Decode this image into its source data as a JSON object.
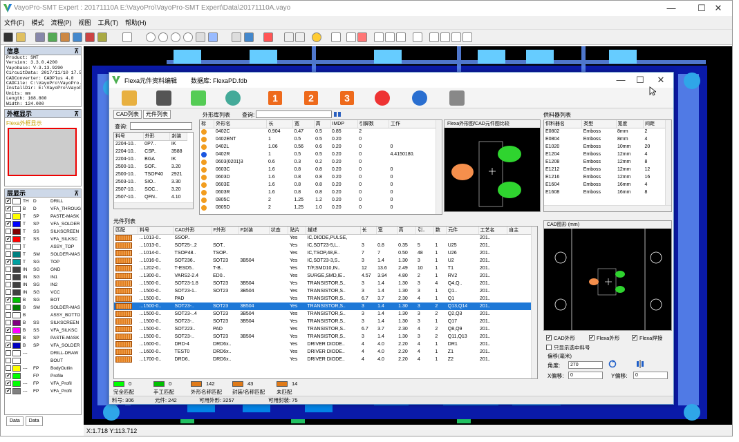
{
  "window": {
    "title": "VayoPro-SMT Expert : 20171110A    E:\\VayoPro\\VayoPro-SMT Expert\\Data\\20171110A.vayo",
    "minimize": "—",
    "maximize": "☐",
    "close": "✕"
  },
  "menu": [
    "文件(F)",
    "模式",
    "流程(P)",
    "视图",
    "工具(T)",
    "帮助(H)"
  ],
  "info_panel": {
    "title": "信息",
    "pin": "⊼",
    "lines": [
      "Product: SMT",
      "Version: 3.3.0.4200",
      "Vayobase: V-3.13.9290",
      "CircuitData: 2017/11/10 17.5",
      "CADConverter: CADPlus 4.0",
      "CADFile: C:\\VayoPro\\VayoPro..",
      "InstallDir: E:\\VayoPro\\VayoPro",
      "Units: mm",
      "Length: 168.800",
      "Width: 124.000",
      "Thickness: 0.000"
    ]
  },
  "ext_panel": {
    "title": "外框显示",
    "pin": "⊼",
    "label": "Flexa外框显示"
  },
  "layers_panel": {
    "title": "层显示",
    "pin": "⊼",
    "rows": [
      {
        "checked": "✔",
        "color": "#ffffff",
        "ab": "TH",
        "nm": "D",
        "label": "DRILL"
      },
      {
        "checked": "✔",
        "color": "#ffffff",
        "ab": "B",
        "nm": "D",
        "label": "VFA_THROUGH"
      },
      {
        "checked": "",
        "color": "#ffff00",
        "ab": "T",
        "nm": "SP",
        "label": "PASTE-MASK"
      },
      {
        "checked": "✔",
        "color": "#0000ff",
        "ab": "T",
        "nm": "SP",
        "label": "VFA_SOLDER"
      },
      {
        "checked": "",
        "color": "#800000",
        "ab": "T",
        "nm": "SS",
        "label": "SILKSCREEN"
      },
      {
        "checked": "✔",
        "color": "#ff0000",
        "ab": "T",
        "nm": "SS",
        "label": "VFA_SILKSC"
      },
      {
        "checked": "",
        "color": "#ffffff",
        "ab": "T",
        "nm": "",
        "label": "ASSY_TOP"
      },
      {
        "checked": "",
        "color": "#008080",
        "ab": "T",
        "nm": "SM",
        "label": "SOLDER-MAS"
      },
      {
        "checked": "✔",
        "color": "#00a0a0",
        "ab": "T",
        "nm": "SG",
        "label": "TOP"
      },
      {
        "checked": "",
        "color": "#404040",
        "ab": "IN",
        "nm": "SG",
        "label": "GND"
      },
      {
        "checked": "",
        "color": "#404040",
        "ab": "IN",
        "nm": "SG",
        "label": "IN1"
      },
      {
        "checked": "",
        "color": "#404040",
        "ab": "IN",
        "nm": "SG",
        "label": "IN2"
      },
      {
        "checked": "",
        "color": "#404040",
        "ab": "IN",
        "nm": "SG",
        "label": "VCC"
      },
      {
        "checked": "✔",
        "color": "#00c000",
        "ab": "B",
        "nm": "SG",
        "label": "BOT"
      },
      {
        "checked": "",
        "color": "#008000",
        "ab": "B",
        "nm": "SM",
        "label": "SOLDER-MAS"
      },
      {
        "checked": "",
        "color": "#ffffff",
        "ab": "B",
        "nm": "",
        "label": "ASSY_BOTTO"
      },
      {
        "checked": "",
        "color": "#800080",
        "ab": "B",
        "nm": "SS",
        "label": "SILKSCREEN"
      },
      {
        "checked": "✔",
        "color": "#ff00ff",
        "ab": "B",
        "nm": "SS",
        "label": "VFA_SILKSC"
      },
      {
        "checked": "",
        "color": "#808000",
        "ab": "B",
        "nm": "SP",
        "label": "PASTE-MASK"
      },
      {
        "checked": "✔",
        "color": "#0000c0",
        "ab": "B",
        "nm": "SP",
        "label": "VFA_SOLDER"
      },
      {
        "checked": "",
        "color": "#ffffff",
        "ab": "---",
        "nm": "",
        "label": "DRILL-DRAW"
      },
      {
        "checked": "",
        "color": "#ffffff",
        "ab": "",
        "nm": "",
        "label": "BOUT"
      },
      {
        "checked": "",
        "color": "#ffff00",
        "ab": "---",
        "nm": "FP",
        "label": "BodyOutlin"
      },
      {
        "checked": "✔",
        "color": "#00ff00",
        "ab": "",
        "nm": "FP",
        "label": "Profile"
      },
      {
        "checked": "✔",
        "color": "#00ff00",
        "ab": "---",
        "nm": "FP",
        "label": "VFA_Profil"
      },
      {
        "checked": "✔",
        "color": "#808080",
        "ab": "---",
        "nm": "FP",
        "label": "VFA_Profil"
      }
    ]
  },
  "bottom_tabs": [
    "Data",
    "Data"
  ],
  "statusbar": {
    "coords": "X:1.718 Y:113.712"
  },
  "dialog": {
    "title": "Flexa元件资料编辑",
    "subtitle": "数据库: FlexaPD.fdb",
    "close": "✕",
    "maximize": "☐",
    "minimize": "—",
    "numbers": [
      "1",
      "2",
      "3"
    ],
    "tabs": [
      "CAD列表",
      "元件列表"
    ],
    "search_label": "查询:",
    "cad_header": [
      "料号",
      "外形",
      "封装"
    ],
    "cad_rows": [
      [
        "2204-10..",
        "0P7..",
        "IK"
      ],
      [
        "2204-10..",
        "CSP..",
        "3588"
      ],
      [
        "2204-10..",
        "BGA",
        "IK"
      ],
      [
        "2500-10..",
        "SOF..",
        "3.20"
      ],
      [
        "2500-10..",
        "TSOP40",
        "2921"
      ],
      [
        "2503-10..",
        "SIO..",
        "3.30"
      ],
      [
        "2507-10..",
        "SOC..",
        "3.20"
      ],
      [
        "2507-10..",
        "QFN..",
        "4.10"
      ]
    ],
    "shape_list_title": "外形库列表",
    "shape_search_label": "查询:",
    "shape_header": [
      "标",
      "外形名",
      "长",
      "宽",
      "高",
      "IMDP",
      "引脚数",
      "工作"
    ],
    "shape_rows": [
      {
        "color": "#f29d1f",
        "name": "0402C",
        "l": "0.904",
        "w": "0.47",
        "h": "0.5",
        "imdp": "0.85",
        "p": "2",
        "t": ""
      },
      {
        "color": "#f29d1f",
        "name": "0402ENT",
        "l": "1",
        "w": "0.5",
        "h": "0.5",
        "imdp": "0.20",
        "p": "0",
        "t": ""
      },
      {
        "color": "#f29d1f",
        "name": "0402L",
        "l": "1.06",
        "w": "0.56",
        "h": "0.6",
        "imdp": "0.20",
        "p": "0",
        "t": "0"
      },
      {
        "color": "#1b56e0",
        "name": "0402R",
        "l": "1",
        "w": "0.5",
        "h": "0.5",
        "imdp": "0.20",
        "p": "0",
        "t": "4.4150180."
      },
      {
        "color": "#f29d1f",
        "name": "0603(0201)3",
        "l": "0.6",
        "w": "0.3",
        "h": "0.2",
        "imdp": "0.20",
        "p": "0",
        "t": ""
      },
      {
        "color": "#f29d1f",
        "name": "0603C",
        "l": "1.6",
        "w": "0.8",
        "h": "0.8",
        "imdp": "0.20",
        "p": "0",
        "t": "0"
      },
      {
        "color": "#f29d1f",
        "name": "0603D",
        "l": "1.6",
        "w": "0.8",
        "h": "0.8",
        "imdp": "0.20",
        "p": "0",
        "t": "0"
      },
      {
        "color": "#f29d1f",
        "name": "0603E",
        "l": "1.6",
        "w": "0.8",
        "h": "0.8",
        "imdp": "0.20",
        "p": "0",
        "t": "0"
      },
      {
        "color": "#f29d1f",
        "name": "0603R",
        "l": "1.6",
        "w": "0.8",
        "h": "0.8",
        "imdp": "0.20",
        "p": "0",
        "t": "0"
      },
      {
        "color": "#f29d1f",
        "name": "0805C",
        "l": "2",
        "w": "1.25",
        "h": "1.2",
        "imdp": "0.20",
        "p": "0",
        "t": "0"
      },
      {
        "color": "#f29d1f",
        "name": "0805D",
        "l": "2",
        "w": "1.25",
        "h": "1.0",
        "imdp": "0.20",
        "p": "0",
        "t": "0"
      }
    ],
    "preview_title": "Flexa外形图/CAD元件图比较",
    "feeder_title": "供料器列表",
    "feeder_header": [
      "供料器名",
      "类型",
      "宽度",
      "间距"
    ],
    "feeder_rows": [
      [
        "E0802",
        "Emboss",
        "8mm",
        "2"
      ],
      [
        "E0804",
        "Emboss",
        "8mm",
        "4"
      ],
      [
        "E1020",
        "Emboss",
        "10mm",
        "20"
      ],
      [
        "E1204",
        "Emboss",
        "12mm",
        "4"
      ],
      [
        "E1208",
        "Emboss",
        "12mm",
        "8"
      ],
      [
        "E1212",
        "Emboss",
        "12mm",
        "12"
      ],
      [
        "E1216",
        "Emboss",
        "12mm",
        "16"
      ],
      [
        "E1604",
        "Emboss",
        "16mm",
        "4"
      ],
      [
        "E1608",
        "Emboss",
        "16mm",
        "8"
      ]
    ],
    "part_list_title": "元件列表",
    "part_header": [
      "匹配",
      "料号",
      "CAD外形",
      "F外形",
      "F封装",
      "状态",
      "贴片",
      "描述",
      "长",
      "宽",
      "高",
      "引..",
      "数",
      "元件",
      "工艺名",
      "自主"
    ],
    "part_rows": [
      {
        "m": "",
        "pn": "...1013-0..",
        "cad": "SSOP..",
        "fs": "",
        "fp": "",
        "st": "",
        "x": "Yes",
        "d": "IC,DIODE,PULSE,",
        "l": "",
        "w": "",
        "h": "",
        "p": "",
        "n": "",
        "c": "",
        "pr": "201..",
        "a": ""
      },
      {
        "m": "",
        "pn": "...1013-0..",
        "cad": "SOT25-..2",
        "fs": "SOT..",
        "fp": "",
        "st": "",
        "x": "Yes",
        "d": "IC,SOT23-5,L..",
        "l": "3",
        "w": "0.8",
        "h": "0.35",
        "p": "5",
        "n": "1",
        "c": "U25",
        "pr": "201..",
        "a": ""
      },
      {
        "m": "",
        "pn": "...1014-0..",
        "cad": "TSOP48..",
        "fs": "TSOP..",
        "fp": "",
        "st": "",
        "x": "Yes",
        "d": "IC,TSOP,48,E..",
        "l": "7",
        "w": "7",
        "h": "0.50",
        "p": "48",
        "n": "1",
        "c": "U26",
        "pr": "201..",
        "a": ""
      },
      {
        "m": "",
        "pn": "...1016-0..",
        "cad": "SOT236..",
        "fs": "SOT23",
        "fp": "3B504",
        "st": "",
        "x": "Yes",
        "d": "IC,SOT23-3,S..",
        "l": "3",
        "w": "1.4",
        "h": "1.30",
        "p": "3",
        "n": "1",
        "c": "U2",
        "pr": "201..",
        "a": ""
      },
      {
        "m": "",
        "pn": "...1202-0..",
        "cad": "T-ESD5..",
        "fs": "T-B..",
        "fp": "",
        "st": "",
        "x": "Yes",
        "d": "T/F,SMD10,IN..",
        "l": "12",
        "w": "13.6",
        "h": "2.49",
        "p": "10",
        "n": "1",
        "c": "T1",
        "pr": "201..",
        "a": ""
      },
      {
        "m": "",
        "pn": "...1300-0..",
        "cad": "VARS2-2.4",
        "fs": "ED0..",
        "fp": "",
        "st": "",
        "x": "Yes",
        "d": "SURGE,SMD,IE..",
        "l": "4.57",
        "w": "3.94",
        "h": "4.80",
        "p": "2",
        "n": "1",
        "c": "RV2",
        "pr": "201..",
        "a": ""
      },
      {
        "m": "",
        "pn": "...1500-0..",
        "cad": "SOT23-1.8",
        "fs": "SOT23",
        "fp": "3B504",
        "st": "",
        "x": "Yes",
        "d": "TRANSISTOR,S..",
        "l": "3",
        "w": "1.4",
        "h": "1.30",
        "p": "3",
        "n": "4",
        "c": "Q4,Q..",
        "pr": "201..",
        "a": ""
      },
      {
        "m": "",
        "pn": "...1500-0..",
        "cad": "SOT23-1..",
        "fs": "SOT23",
        "fp": "3B504",
        "st": "",
        "x": "Yes",
        "d": "TRANSISTOR,S..",
        "l": "3",
        "w": "1.4",
        "h": "1.30",
        "p": "3",
        "n": "1",
        "c": "Q1..",
        "pr": "201..",
        "a": ""
      },
      {
        "m": "",
        "pn": "...1500-0..",
        "cad": "PAD",
        "fs": "",
        "fp": "",
        "st": "",
        "x": "Yes",
        "d": "TRANSISTOR,S..",
        "l": "6.7",
        "w": "3.7",
        "h": "2.30",
        "p": "4",
        "n": "1",
        "c": "Q1",
        "pr": "201..",
        "a": ""
      },
      {
        "m": "",
        "pn": "...1500-0..",
        "cad": "SOT23-..",
        "fs": "SOT23",
        "fp": "3B504",
        "st": "",
        "x": "Yes",
        "d": "TRANSISTOR,S..",
        "l": "3",
        "w": "1.4",
        "h": "1.30",
        "p": "3",
        "n": "2",
        "c": "Q13,Q14",
        "pr": "201..",
        "a": "",
        "selected": true
      },
      {
        "m": "",
        "pn": "...1500-0..",
        "cad": "SOT23-..4",
        "fs": "SOT23",
        "fp": "3B504",
        "st": "",
        "x": "Yes",
        "d": "TRANSISTOR,S..",
        "l": "3",
        "w": "1.4",
        "h": "1.30",
        "p": "3",
        "n": "2",
        "c": "Q2,Q3",
        "pr": "201..",
        "a": ""
      },
      {
        "m": "",
        "pn": "...1500-0..",
        "cad": "SOT23-..",
        "fs": "SOT23",
        "fp": "3B504",
        "st": "",
        "x": "Yes",
        "d": "TRANSISTOR,S..",
        "l": "3",
        "w": "1.4",
        "h": "1.30",
        "p": "3",
        "n": "1",
        "c": "Q17",
        "pr": "201..",
        "a": ""
      },
      {
        "m": "",
        "pn": "...1500-0..",
        "cad": "SOT223..",
        "fs": "PAD",
        "fp": "",
        "st": "",
        "x": "Yes",
        "d": "TRANSISTOR,S..",
        "l": "6.7",
        "w": "3.7",
        "h": "2.30",
        "p": "4",
        "n": "2",
        "c": "Q8,Q9",
        "pr": "201..",
        "a": ""
      },
      {
        "m": "",
        "pn": "...1500-0..",
        "cad": "SOT23-..",
        "fs": "SOT23",
        "fp": "3B504",
        "st": "",
        "x": "Yes",
        "d": "TRANSISTOR,S..",
        "l": "3",
        "w": "1.4",
        "h": "1.30",
        "p": "3",
        "n": "2",
        "c": "Q11,Q13",
        "pr": "201..",
        "a": ""
      },
      {
        "m": "",
        "pn": "...1600-0..",
        "cad": "DRD-4",
        "fs": "DRD6x..",
        "fp": "",
        "st": "",
        "x": "Yes",
        "d": "DRIVER DIODE..",
        "l": "4",
        "w": "4.0",
        "h": "2.20",
        "p": "4",
        "n": "1",
        "c": "DR1",
        "pr": "201..",
        "a": ""
      },
      {
        "m": "",
        "pn": "...1600-0..",
        "cad": "TEST0",
        "fs": "DRD6x..",
        "fp": "",
        "st": "",
        "x": "Yes",
        "d": "DRIVER DIODE..",
        "l": "4",
        "w": "4.0",
        "h": "2.20",
        "p": "4",
        "n": "1",
        "c": "Z1",
        "pr": "201..",
        "a": ""
      },
      {
        "m": "",
        "pn": "...1700-0..",
        "cad": "DRD6..",
        "fs": "DRD6x..",
        "fp": "",
        "st": "",
        "x": "Yes",
        "d": "DRIVER DIODE..",
        "l": "4",
        "w": "4.0",
        "h": "2.20",
        "p": "4",
        "n": "1",
        "c": "Z2",
        "pr": "201..",
        "a": ""
      }
    ],
    "legend": [
      {
        "color": "#00ff00",
        "count": "0",
        "label": "完全匹配"
      },
      {
        "color": "#00c000",
        "count": "0",
        "label": "手工匹配"
      },
      {
        "color": "#e07a18",
        "count": "142",
        "label": "外形名称匹配"
      },
      {
        "color": "#e07a18",
        "count": "43",
        "label": "封装/名称匹配"
      },
      {
        "color": "#e07a18",
        "count": "14",
        "label": "未匹配"
      }
    ],
    "summary": {
      "total": "料号: 306",
      "parts": "元件: 242",
      "matched": "可用外形: 3257",
      "avail": "可用封装: 75"
    },
    "cad_preview_title": "CAD图形 (mm)",
    "options": [
      {
        "label": "CAD外形",
        "checked": "✔"
      },
      {
        "label": "Flexa外形",
        "checked": "✔"
      },
      {
        "label": "Flexa焊接",
        "checked": "✔"
      }
    ],
    "extra_option": "只显示选中料号",
    "offset_title": "偏移(毫米)",
    "angle_label": "角度:",
    "angle_value": "270",
    "x_label": "X偏移:",
    "x_value": "0",
    "y_label": "Y偏移:",
    "y_value": "0"
  }
}
